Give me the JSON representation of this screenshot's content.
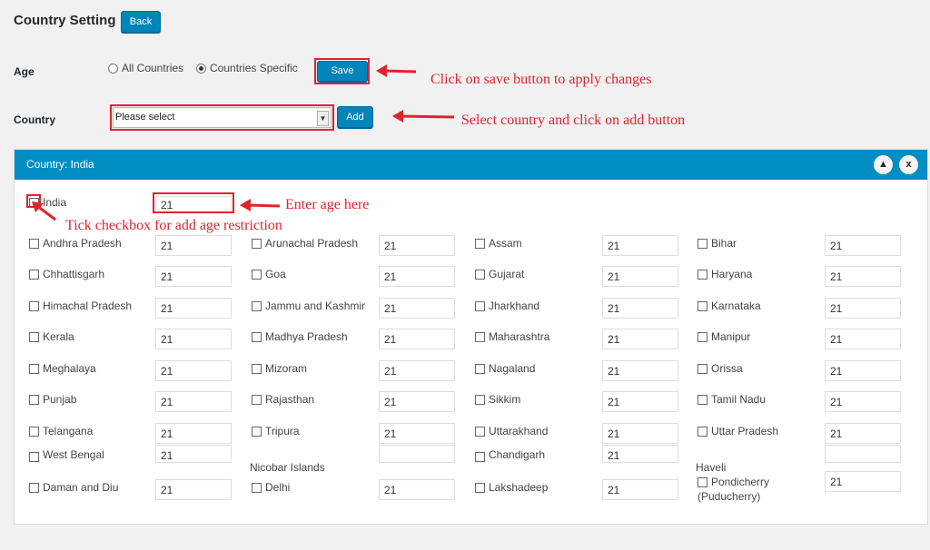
{
  "page": {
    "title": "Country Setting",
    "back_label": "Back"
  },
  "age": {
    "label": "Age",
    "options": [
      "All Countries",
      "Countries Specific"
    ],
    "selected": "Countries Specific",
    "save_label": "Save"
  },
  "country": {
    "label": "Country",
    "select_value": "Please select",
    "add_label": "Add"
  },
  "panel": {
    "title": "Country: India",
    "collapse_symbol": "▲",
    "close_symbol": "x",
    "master": {
      "label": "India",
      "age": "21"
    },
    "states": [
      {
        "label": "Andhra Pradesh",
        "age": "21"
      },
      {
        "label": "Arunachal Pradesh",
        "age": "21"
      },
      {
        "label": "Assam",
        "age": "21"
      },
      {
        "label": "Bihar",
        "age": "21"
      },
      {
        "label": "Chhattisgarh",
        "age": "21"
      },
      {
        "label": "Goa",
        "age": "21"
      },
      {
        "label": "Gujarat",
        "age": "21"
      },
      {
        "label": "Haryana",
        "age": "21"
      },
      {
        "label": "Himachal Pradesh",
        "age": "21"
      },
      {
        "label": "Jammu and Kashmir",
        "age": "21"
      },
      {
        "label": "Jharkhand",
        "age": "21"
      },
      {
        "label": "Karnataka",
        "age": "21"
      },
      {
        "label": "Kerala",
        "age": "21"
      },
      {
        "label": "Madhya Pradesh",
        "age": "21"
      },
      {
        "label": "Maharashtra",
        "age": "21"
      },
      {
        "label": "Manipur",
        "age": "21"
      },
      {
        "label": "Meghalaya",
        "age": "21"
      },
      {
        "label": "Mizoram",
        "age": "21"
      },
      {
        "label": "Nagaland",
        "age": "21"
      },
      {
        "label": "Orissa",
        "age": "21"
      },
      {
        "label": "Punjab",
        "age": "21"
      },
      {
        "label": "Rajasthan",
        "age": "21"
      },
      {
        "label": "Sikkim",
        "age": "21"
      },
      {
        "label": "Tamil Nadu",
        "age": "21"
      },
      {
        "label": "Telangana",
        "age": "21"
      },
      {
        "label": "Tripura",
        "age": "21"
      },
      {
        "label": "Uttarakhand",
        "age": "21"
      },
      {
        "label": "Uttar Pradesh",
        "age": "21"
      },
      {
        "label": "West Bengal",
        "age": "21"
      },
      {
        "label": "Nicobar Islands",
        "age": ""
      },
      {
        "label": "Chandigarh",
        "age": "21"
      },
      {
        "label": "Haveli",
        "age": ""
      },
      {
        "label": "Daman and Diu",
        "age": "21"
      },
      {
        "label": "Delhi",
        "age": "21"
      },
      {
        "label": "Lakshadeep",
        "age": "21"
      },
      {
        "label": "Pondicherry (Puducherry)",
        "age": "21"
      }
    ]
  },
  "annotations": {
    "save": "Click on save button to apply changes",
    "add": "Select country and click on add button",
    "age": "Enter age here",
    "checkbox": "Tick checkbox for add age restriction"
  },
  "colors": {
    "accent": "#0085ba",
    "header": "#008ec2",
    "annotation": "#e0242d"
  }
}
